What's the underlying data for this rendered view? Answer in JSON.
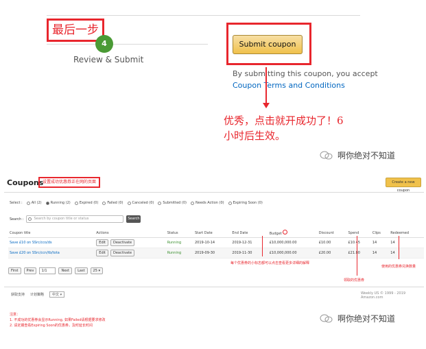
{
  "top": {
    "step_label": "最后一步",
    "step_number": "4",
    "step_name": "Review & Submit",
    "submit_button": "Submit coupon",
    "consent_text": "By submitting this coupon, you accept",
    "terms_link": "Coupon Terms and Conditions",
    "note_line1": "优秀，点击就开成功了！6",
    "note_line2": "小时后生效。",
    "watermark": "啊你绝对不知道"
  },
  "coupons": {
    "title": "Coupons",
    "title_note": "设置成功优惠券正在网的页面",
    "create_button": "Create a new coupon",
    "select_label": "Select :",
    "filters": [
      {
        "label": "All (2)",
        "selected": false
      },
      {
        "label": "Running (2)",
        "selected": true
      },
      {
        "label": "Expired (0)",
        "selected": false
      },
      {
        "label": "Failed (0)",
        "selected": false
      },
      {
        "label": "Canceled (0)",
        "selected": false
      },
      {
        "label": "Submitted (0)",
        "selected": false
      },
      {
        "label": "Needs Action (0)",
        "selected": false
      },
      {
        "label": "Expiring Soon (0)",
        "selected": false
      }
    ],
    "search_label": "Search :",
    "search_placeholder": "Search by coupon title or status",
    "search_button": "Search",
    "columns": [
      "Coupon title",
      "Actions",
      "Status",
      "Start Date",
      "End Date",
      "Budget",
      "Discount",
      "Spend",
      "Clips",
      "Redeemed"
    ],
    "rows": [
      {
        "title": "Save £10 on SSrc/cco/ds",
        "edit": "Edit",
        "deactivate": "Deactivate",
        "status": "Running",
        "start": "2019-10-14",
        "end": "2019-12-31",
        "budget": "£10,000,000.00",
        "discount": "£10.00",
        "spend": "£10.45",
        "clips": "14",
        "redeemed": "14"
      },
      {
        "title": "Save £20 on SSrc/ccn/tb/tota",
        "edit": "Edit",
        "deactivate": "Deactivate",
        "status": "Running",
        "start": "2019-09-30",
        "end": "2019-11-30",
        "budget": "£10,000,000.00",
        "discount": "£20.00",
        "spend": "£21.80",
        "clips": "14",
        "redeemed": "14"
      }
    ],
    "pager": {
      "first": "First",
      "prev": "Prev",
      "page": "1/1",
      "next": "Next",
      "last": "Last",
      "per_page": "25"
    },
    "annot_budget": "每个优惠券的小标志都可以点击查看更多详细的解释",
    "annot_clips": "领取的优惠券",
    "annot_redeemed": "使用的优惠券兑换数量",
    "footer": {
      "link1": "获取支持",
      "link2": "计划策略",
      "lang": "中文",
      "right": "Weekly US    © 1999 - 2019 Amazon.com"
    },
    "notes_title": "注意：",
    "note1": "1. 不成功的优惠券会显示Running, 如果Failed请根据要求修改",
    "note2": "2. 请定期查看Expiring Soon的优惠券，及时延长时间"
  },
  "colors": {
    "accent_red": "#e8262d",
    "step_green": "#4a9a35",
    "button_gold": "#f0c14b",
    "link_blue": "#0066c0"
  }
}
